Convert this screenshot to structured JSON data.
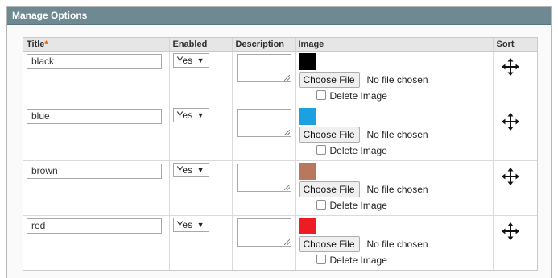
{
  "panel": {
    "title": "Manage Options"
  },
  "table": {
    "headers": {
      "title": "Title",
      "required_mark": "*",
      "enabled": "Enabled",
      "description": "Description",
      "image": "Image",
      "sort": "Sort"
    },
    "rows": [
      {
        "title": "black",
        "enabled": "Yes",
        "description": "",
        "color": "#000000",
        "file_button": "Choose File",
        "file_status": "No file chosen",
        "delete_label": "Delete Image",
        "sort_icon": "move-arrows-icon"
      },
      {
        "title": "blue",
        "enabled": "Yes",
        "description": "",
        "color": "#1ba1e2",
        "file_button": "Choose File",
        "file_status": "No file chosen",
        "delete_label": "Delete Image",
        "sort_icon": "move-arrows-icon"
      },
      {
        "title": "brown",
        "enabled": "Yes",
        "description": "",
        "color": "#b9775b",
        "file_button": "Choose File",
        "file_status": "No file chosen",
        "delete_label": "Delete Image",
        "sort_icon": "move-arrows-icon"
      },
      {
        "title": "red",
        "enabled": "Yes",
        "description": "",
        "color": "#ed1c24",
        "file_button": "Choose File",
        "file_status": "No file chosen",
        "delete_label": "Delete Image",
        "sort_icon": "move-arrows-icon"
      }
    ]
  },
  "colors": {
    "header_bg": "#6f8992",
    "required_mark": "#eb5e00"
  }
}
